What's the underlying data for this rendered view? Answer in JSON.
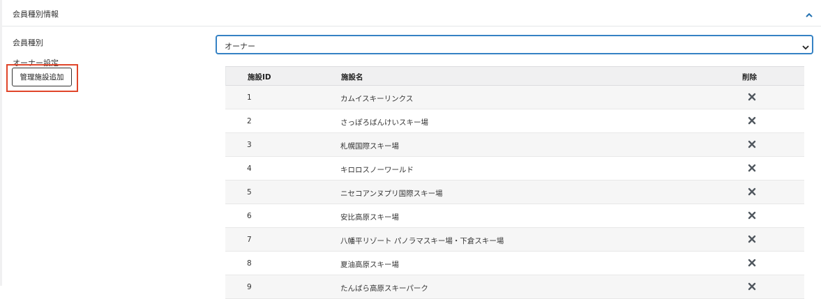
{
  "panel": {
    "title": "会員種別情報"
  },
  "form": {
    "member_type_label": "会員種別",
    "member_type_value": "オーナー",
    "owner_settings_label": "オーナー設定",
    "add_facility_button": "管理施設追加"
  },
  "table": {
    "headers": {
      "id": "施設ID",
      "name": "施設名",
      "delete": "削除"
    },
    "rows": [
      {
        "id": "1",
        "name": "カムイスキーリンクス"
      },
      {
        "id": "2",
        "name": "さっぽろばんけいスキー場"
      },
      {
        "id": "3",
        "name": "札幌国際スキー場"
      },
      {
        "id": "4",
        "name": "キロロスノーワールド"
      },
      {
        "id": "5",
        "name": "ニセコアンヌプリ国際スキー場"
      },
      {
        "id": "6",
        "name": "安比高原スキー場"
      },
      {
        "id": "7",
        "name": "八幡平リゾート パノラマスキー場・下倉スキー場"
      },
      {
        "id": "8",
        "name": "夏油高原スキー場"
      },
      {
        "id": "9",
        "name": "たんばら高原スキーパーク"
      }
    ]
  },
  "colors": {
    "accent": "#3582c4",
    "highlight": "#e0452a",
    "delete_icon": "#50575e"
  },
  "icons": {
    "collapse": "chevron-up-icon",
    "select": "chevron-down-icon",
    "delete": "close-icon"
  }
}
